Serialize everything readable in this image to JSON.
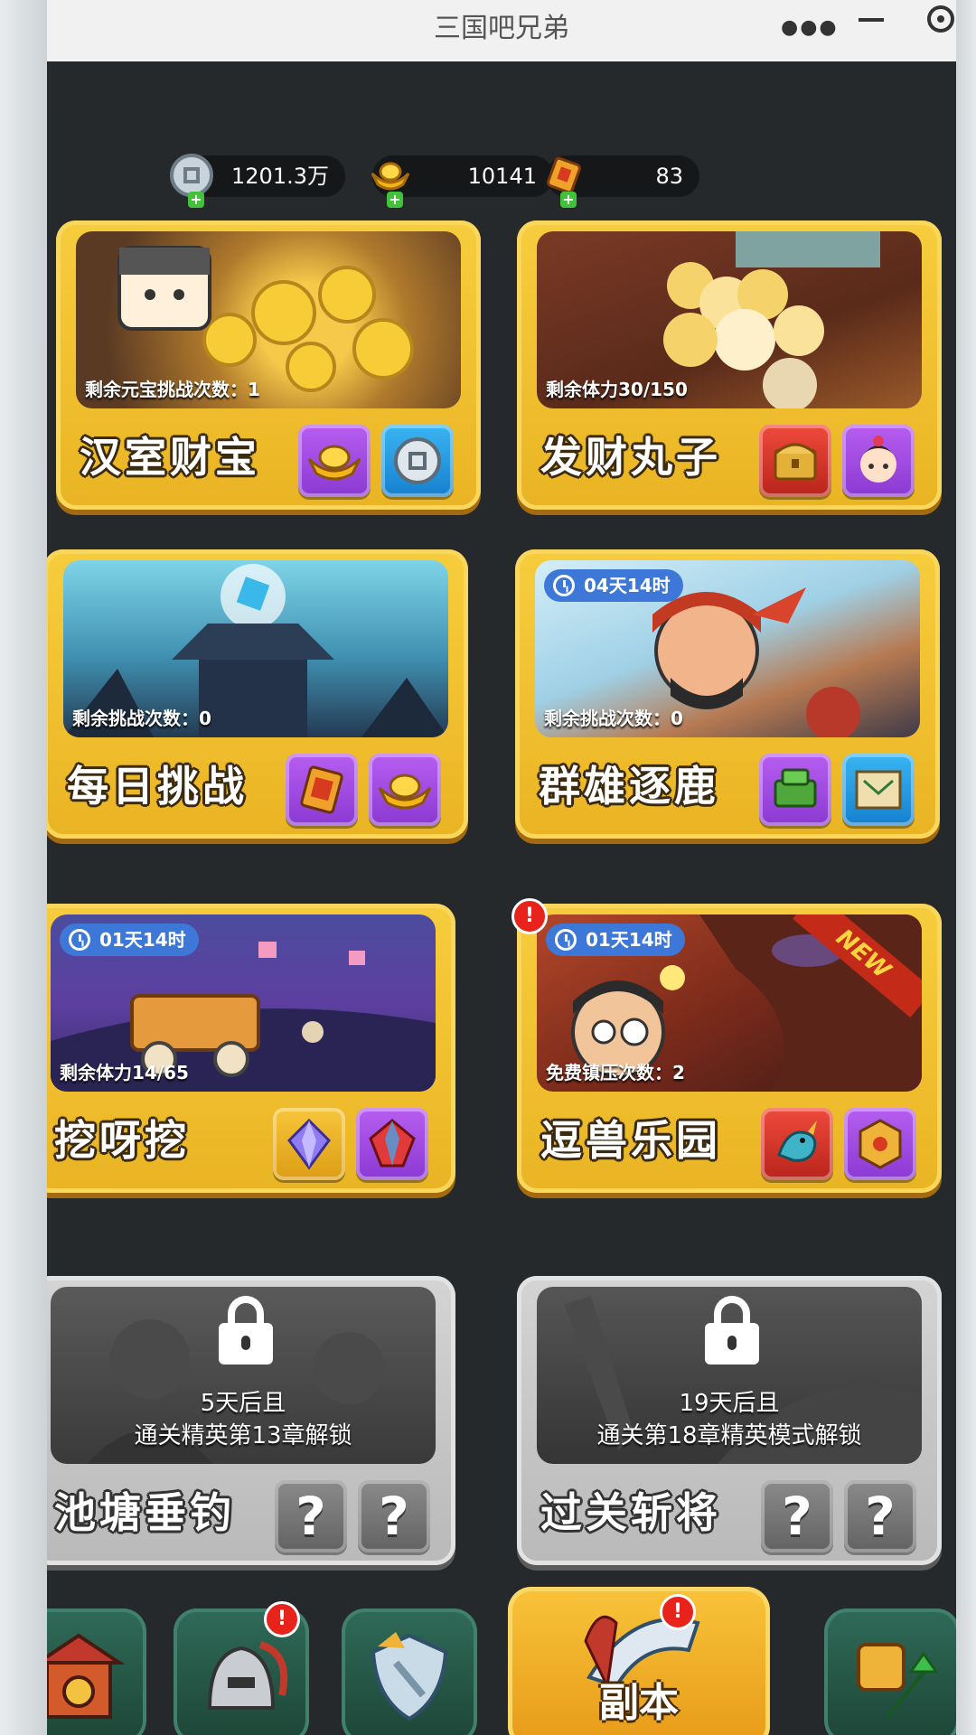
{
  "window": {
    "title": "三国吧兄弟"
  },
  "currencies": [
    {
      "icon": "silver-coin-icon",
      "value": "1201.3万"
    },
    {
      "icon": "gold-ingot-icon",
      "value": "10141"
    },
    {
      "icon": "scroll-token-icon",
      "value": "83"
    }
  ],
  "cards": [
    {
      "name": "汉室财宝",
      "subtitle": "剩余元宝挑战次数：1",
      "timer": "",
      "rewards": [
        "gold-ingot-icon",
        "silver-coin-icon"
      ]
    },
    {
      "name": "发财丸子",
      "subtitle": "剩余体力30/150",
      "timer": "",
      "rewards": [
        "treasure-chest-icon",
        "hero-portrait-icon"
      ]
    },
    {
      "name": "每日挑战",
      "subtitle": "剩余挑战次数：0",
      "timer": "",
      "rewards": [
        "scroll-token-icon",
        "gold-ingot-icon"
      ]
    },
    {
      "name": "群雄逐鹿",
      "subtitle": "剩余挑战次数：0",
      "timer": "04天14时",
      "rewards": [
        "jade-seal-icon",
        "map-scroll-icon"
      ]
    },
    {
      "name": "挖呀挖",
      "subtitle": "剩余体力14/65",
      "timer": "01天14时",
      "rewards": [
        "purple-gem-icon",
        "red-gem-icon"
      ]
    },
    {
      "name": "逗兽乐园",
      "subtitle": "免费镇压次数：2",
      "timer": "01天14时",
      "new_label": "NEW",
      "alert": "!",
      "rewards": [
        "dragon-pet-icon",
        "treasure-box-icon"
      ]
    }
  ],
  "locked_cards": [
    {
      "name": "池塘垂钓",
      "unlock_line1": "5天后且",
      "unlock_line2": "通关精英第13章解锁",
      "rewards": [
        "?",
        "?"
      ]
    },
    {
      "name": "过关斩将",
      "unlock_line1": "19天后且",
      "unlock_line2": "通关第18章精英模式解锁",
      "rewards": [
        "?",
        "?"
      ]
    }
  ],
  "bottom_nav": {
    "items": [
      {
        "icon": "city-gate-icon",
        "label": ""
      },
      {
        "icon": "helmet-icon",
        "label": "",
        "badge": "!"
      },
      {
        "icon": "shield-icon",
        "label": ""
      },
      {
        "icon": "sword-icon",
        "label": "副本",
        "badge": "!"
      },
      {
        "icon": "upgrade-arrow-icon",
        "label": ""
      }
    ]
  },
  "colors": {
    "card_gold": "#eab424",
    "card_locked": "#b9b9b9",
    "timer_blue": "#3d78d8",
    "alert_red": "#e8231b",
    "nav_green": "#2f6a58"
  }
}
